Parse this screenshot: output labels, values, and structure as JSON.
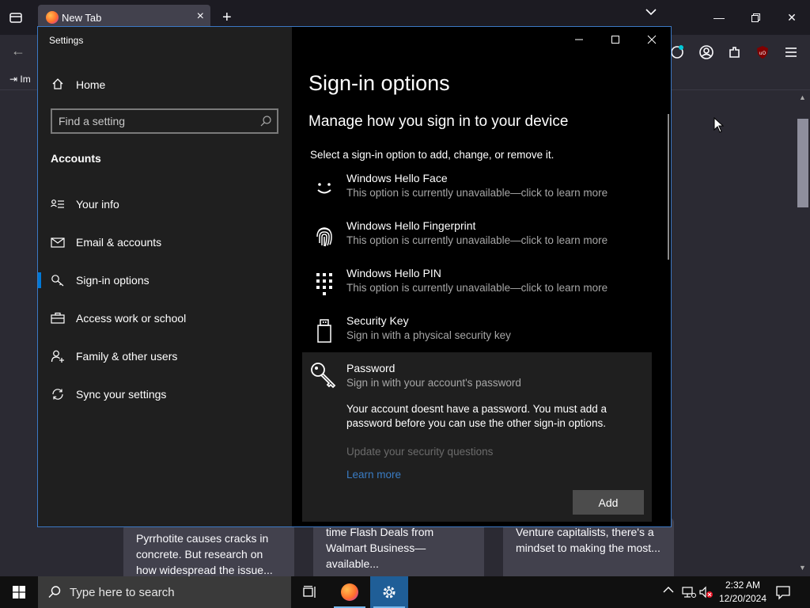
{
  "browser": {
    "tab_title": "New Tab",
    "import_label": "Im",
    "news": [
      "Pyrrhotite causes cracks in concrete. But research on how widespread the issue...",
      "time Flash Deals from Walmart Business—available...",
      "Venture capitalists, there's a mindset to making the most..."
    ]
  },
  "settings": {
    "window_title": "Settings",
    "home_label": "Home",
    "search_placeholder": "Find a setting",
    "section_heading": "Accounts",
    "nav": [
      {
        "label": "Your info",
        "icon": "person-card-icon"
      },
      {
        "label": "Email & accounts",
        "icon": "envelope-icon"
      },
      {
        "label": "Sign-in options",
        "icon": "key-icon",
        "active": true
      },
      {
        "label": "Access work or school",
        "icon": "briefcase-icon"
      },
      {
        "label": "Family & other users",
        "icon": "person-add-icon"
      },
      {
        "label": "Sync your settings",
        "icon": "sync-icon"
      }
    ],
    "page_title": "Sign-in options",
    "page_subtitle": "Manage how you sign in to your device",
    "page_description": "Select a sign-in option to add, change, or remove it.",
    "options": [
      {
        "name": "Windows Hello Face",
        "sub": "This option is currently unavailable—click to learn more",
        "icon": "face-icon"
      },
      {
        "name": "Windows Hello Fingerprint",
        "sub": "This option is currently unavailable—click to learn more",
        "icon": "fingerprint-icon"
      },
      {
        "name": "Windows Hello PIN",
        "sub": "This option is currently unavailable—click to learn more",
        "icon": "pin-keypad-icon"
      },
      {
        "name": "Security Key",
        "sub": "Sign in with a physical security key",
        "icon": "usb-key-icon"
      }
    ],
    "password": {
      "name": "Password",
      "sub": "Sign in with your account's password",
      "message": "Your account doesnt have a password. You must add a password before you can use the other sign-in options.",
      "security_questions": "Update your security questions",
      "learn_more": "Learn more",
      "add_button": "Add"
    }
  },
  "taskbar": {
    "search_placeholder": "Type here to search",
    "time": "2:32 AM",
    "date": "12/20/2024"
  },
  "colors": {
    "accent": "#0078d7",
    "link": "#3a7cc4",
    "panel": "#1f1f1f"
  }
}
